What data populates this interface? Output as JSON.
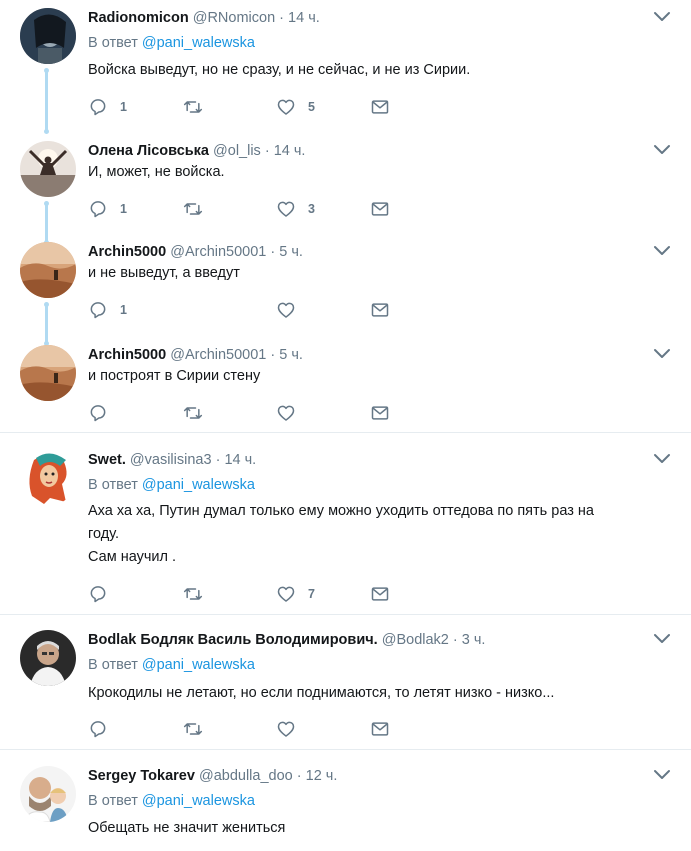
{
  "reply_prefix": "В ответ",
  "tweets": [
    {
      "name": "Radionomicon",
      "handle": "@RNomicon",
      "dot": "·",
      "time": "14 ч.",
      "reply_to": "@pani_walewska",
      "text_lines": [
        "Войска выведут, но не сразу, и не сейчас, и не из Сирии."
      ],
      "replies": "1",
      "retweets": "",
      "likes": "5"
    },
    {
      "name": "Олена Лісовська",
      "handle": "@ol_lis",
      "dot": "·",
      "time": "14 ч.",
      "text_lines": [
        "И, может, не войска."
      ],
      "replies": "1",
      "retweets": "",
      "likes": "3"
    },
    {
      "name": "Archin5000",
      "handle": "@Archin50001",
      "dot": "·",
      "time": "5 ч.",
      "text_lines": [
        "и не выведут, а введут"
      ],
      "replies": "1",
      "retweets": "",
      "likes": ""
    },
    {
      "name": "Archin5000",
      "handle": "@Archin50001",
      "dot": "·",
      "time": "5 ч.",
      "text_lines": [
        "и построят в Сирии стену"
      ],
      "replies": "",
      "retweets": "",
      "likes": ""
    },
    {
      "name": "Swet.",
      "handle": "@vasilisina3",
      "dot": "·",
      "time": "14 ч.",
      "reply_to": "@pani_walewska",
      "text_lines": [
        "Аха  ха ха, Путин думал только ему можно уходить оттедова по пять раз на",
        "году.",
        "Сам научил ."
      ],
      "replies": "",
      "retweets": "",
      "likes": "7"
    },
    {
      "name": "Bodlak Бодляк Василь Володимирович.",
      "handle": "@Bodlak2",
      "dot": "·",
      "time": "3 ч.",
      "reply_to": "@pani_walewska",
      "text_lines": [
        "Крокодилы не летают, но если поднимаются, то летят низко - низко..."
      ],
      "replies": "",
      "retweets": "",
      "likes": ""
    },
    {
      "name": "Sergey Tokarev",
      "handle": "@abdulla_doo",
      "dot": "·",
      "time": "12 ч.",
      "reply_to": "@pani_walewska",
      "text_lines": [
        "Обещать не значит жениться"
      ],
      "replies": "",
      "retweets": "",
      "likes": ""
    }
  ],
  "colors": {
    "text": "#14171a",
    "muted": "#657786",
    "link": "#1b95e0",
    "thread_line": "#b0daf2",
    "separator": "#e6ecf0"
  }
}
